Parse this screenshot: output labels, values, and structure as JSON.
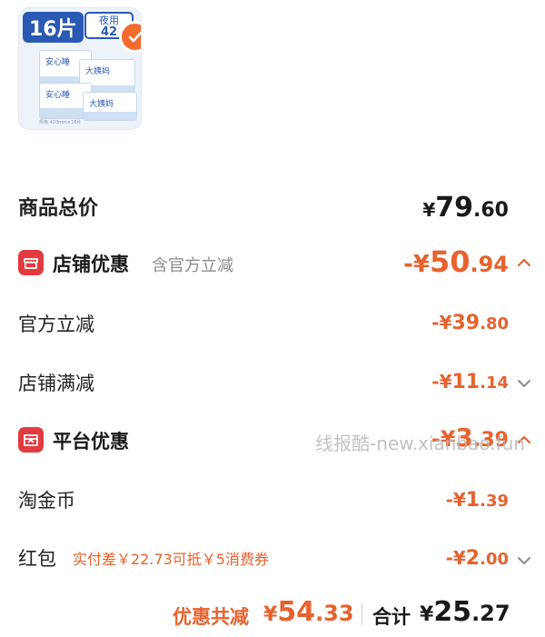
{
  "product": {
    "pack_badge": "16片",
    "tag_top": "夜用",
    "tag_size": "42",
    "box_title_a": "安心睡",
    "box_title_b": "大姨妈",
    "foot_text": "规格 420mm×16片"
  },
  "rows": {
    "total": {
      "label": "商品总价",
      "currency": "¥",
      "int": "79",
      "dec": ".60"
    },
    "store_discount": {
      "label": "店铺优惠",
      "sub": "含官方立减",
      "currency": "-¥",
      "int": "50",
      "dec": ".94",
      "chevron_icon": "chevron-up-icon"
    },
    "official_cut": {
      "label": "官方立减",
      "currency": "-¥",
      "int": "39",
      "dec": ".80"
    },
    "store_full_cut": {
      "label": "店铺满减",
      "currency": "-¥",
      "int": "11",
      "dec": ".14",
      "chevron_icon": "chevron-down-icon"
    },
    "platform_discount": {
      "label": "平台优惠",
      "currency": "-¥",
      "int": "3",
      "dec": ".39",
      "chevron_icon": "chevron-up-icon"
    },
    "taojinbi": {
      "label": "淘金币",
      "currency": "-¥",
      "int": "1",
      "dec": ".39"
    },
    "red_packet": {
      "label": "红包",
      "note": "实付差￥22.73可抵￥5消费券",
      "currency": "-¥",
      "int": "2",
      "dec": ".00",
      "chevron_icon": "chevron-down-icon"
    }
  },
  "footer": {
    "discount_label": "优惠共减",
    "discount_currency": "¥",
    "discount_int": "54",
    "discount_dec": ".33",
    "total_label": "合计",
    "total_currency": "¥",
    "total_int": "25",
    "total_dec": ".27"
  },
  "watermark": "线报酷-new.xianbao.fun",
  "colors": {
    "accent": "#e7622e",
    "store_icon": "#e13b3f",
    "badge_blue": "#2a59b4"
  }
}
